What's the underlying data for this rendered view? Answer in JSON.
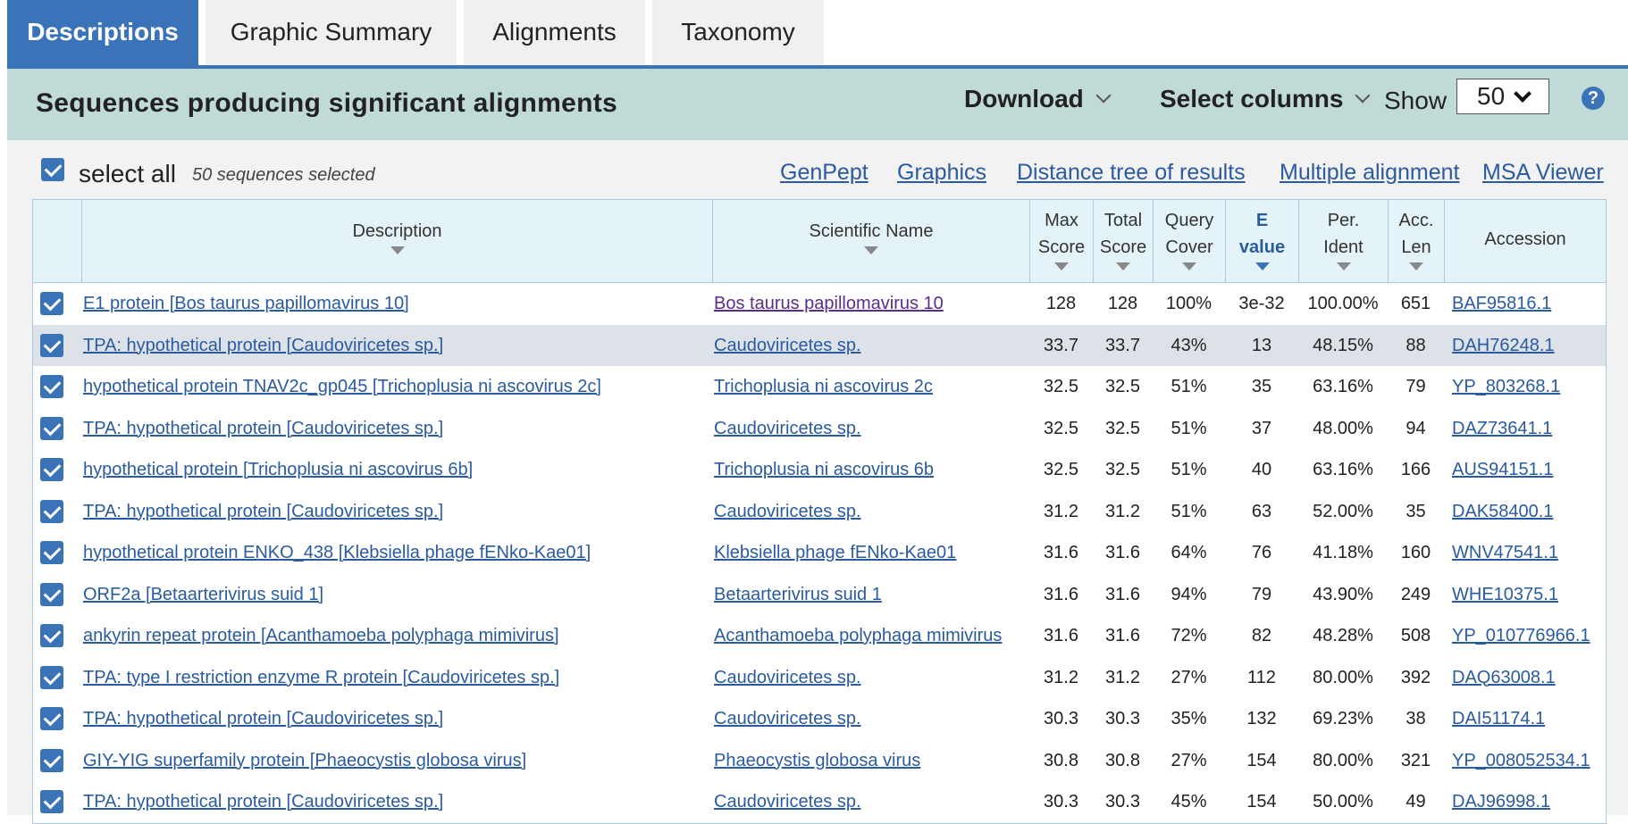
{
  "tabs": [
    {
      "label": "Descriptions",
      "active": true
    },
    {
      "label": "Graphic Summary",
      "active": false
    },
    {
      "label": "Alignments",
      "active": false
    },
    {
      "label": "Taxonomy",
      "active": false
    }
  ],
  "header": {
    "title": "Sequences producing significant alignments",
    "download_label": "Download",
    "select_columns_label": "Select columns",
    "show_label": "Show",
    "show_value": "50",
    "help_icon": "?"
  },
  "toolbar": {
    "select_all_label": "select all",
    "selected_count": "50 sequences selected",
    "links": [
      "GenPept",
      "Graphics",
      "Distance tree of results",
      "Multiple alignment",
      "MSA Viewer"
    ]
  },
  "table": {
    "headers": {
      "description": "Description",
      "scientific_name": "Scientific Name",
      "max_score_1": "Max",
      "max_score_2": "Score",
      "total_score_1": "Total",
      "total_score_2": "Score",
      "query_cover_1": "Query",
      "query_cover_2": "Cover",
      "evalue_1": "E",
      "evalue_2": "value",
      "per_ident_1": "Per.",
      "per_ident_2": "Ident",
      "acc_len_1": "Acc.",
      "acc_len_2": "Len",
      "accession": "Accession"
    },
    "rows": [
      {
        "description": "E1 protein [Bos taurus papillomavirus 10]",
        "scientific_name": "Bos taurus papillomavirus 10",
        "max_score": "128",
        "total_score": "128",
        "query_cover": "100%",
        "evalue": "3e-32",
        "per_ident": "100.00%",
        "acc_len": "651",
        "accession": "BAF95816.1"
      },
      {
        "description": "TPA: hypothetical protein [Caudoviricetes sp.]",
        "scientific_name": "Caudoviricetes sp.",
        "max_score": "33.7",
        "total_score": "33.7",
        "query_cover": "43%",
        "evalue": "13",
        "per_ident": "48.15%",
        "acc_len": "88",
        "accession": "DAH76248.1"
      },
      {
        "description": "hypothetical protein TNAV2c_gp045 [Trichoplusia ni ascovirus 2c]",
        "scientific_name": "Trichoplusia ni ascovirus 2c",
        "max_score": "32.5",
        "total_score": "32.5",
        "query_cover": "51%",
        "evalue": "35",
        "per_ident": "63.16%",
        "acc_len": "79",
        "accession": "YP_803268.1"
      },
      {
        "description": "TPA: hypothetical protein [Caudoviricetes sp.]",
        "scientific_name": "Caudoviricetes sp.",
        "max_score": "32.5",
        "total_score": "32.5",
        "query_cover": "51%",
        "evalue": "37",
        "per_ident": "48.00%",
        "acc_len": "94",
        "accession": "DAZ73641.1"
      },
      {
        "description": "hypothetical protein [Trichoplusia ni ascovirus 6b]",
        "scientific_name": "Trichoplusia ni ascovirus 6b",
        "max_score": "32.5",
        "total_score": "32.5",
        "query_cover": "51%",
        "evalue": "40",
        "per_ident": "63.16%",
        "acc_len": "166",
        "accession": "AUS94151.1"
      },
      {
        "description": "TPA: hypothetical protein [Caudoviricetes sp.]",
        "scientific_name": "Caudoviricetes sp.",
        "max_score": "31.2",
        "total_score": "31.2",
        "query_cover": "51%",
        "evalue": "63",
        "per_ident": "52.00%",
        "acc_len": "35",
        "accession": "DAK58400.1"
      },
      {
        "description": "hypothetical protein ENKO_438 [Klebsiella phage fENko-Kae01]",
        "scientific_name": "Klebsiella phage fENko-Kae01",
        "max_score": "31.6",
        "total_score": "31.6",
        "query_cover": "64%",
        "evalue": "76",
        "per_ident": "41.18%",
        "acc_len": "160",
        "accession": "WNV47541.1"
      },
      {
        "description": "ORF2a [Betaarterivirus suid 1]",
        "scientific_name": "Betaarterivirus suid 1",
        "max_score": "31.6",
        "total_score": "31.6",
        "query_cover": "94%",
        "evalue": "79",
        "per_ident": "43.90%",
        "acc_len": "249",
        "accession": "WHE10375.1"
      },
      {
        "description": "ankyrin repeat protein [Acanthamoeba polyphaga mimivirus]",
        "scientific_name": "Acanthamoeba polyphaga mimivirus",
        "max_score": "31.6",
        "total_score": "31.6",
        "query_cover": "72%",
        "evalue": "82",
        "per_ident": "48.28%",
        "acc_len": "508",
        "accession": "YP_010776966.1"
      },
      {
        "description": "TPA: type I restriction enzyme R protein [Caudoviricetes sp.]",
        "scientific_name": "Caudoviricetes sp.",
        "max_score": "31.2",
        "total_score": "31.2",
        "query_cover": "27%",
        "evalue": "112",
        "per_ident": "80.00%",
        "acc_len": "392",
        "accession": "DAQ63008.1"
      },
      {
        "description": "TPA: hypothetical protein [Caudoviricetes sp.]",
        "scientific_name": "Caudoviricetes sp.",
        "max_score": "30.3",
        "total_score": "30.3",
        "query_cover": "35%",
        "evalue": "132",
        "per_ident": "69.23%",
        "acc_len": "38",
        "accession": "DAI51174.1"
      },
      {
        "description": "GIY-YIG superfamily protein [Phaeocystis globosa virus]",
        "scientific_name": "Phaeocystis globosa virus",
        "max_score": "30.8",
        "total_score": "30.8",
        "query_cover": "27%",
        "evalue": "154",
        "per_ident": "80.00%",
        "acc_len": "321",
        "accession": "YP_008052534.1"
      },
      {
        "description": "TPA: hypothetical protein [Caudoviricetes sp.]",
        "scientific_name": "Caudoviricetes sp.",
        "max_score": "30.3",
        "total_score": "30.3",
        "query_cover": "45%",
        "evalue": "154",
        "per_ident": "50.00%",
        "acc_len": "49",
        "accession": "DAJ96998.1"
      }
    ]
  },
  "colors": {
    "accent": "#3b73b9",
    "header_band": "#c0dad7",
    "link": "#2a5ba0",
    "visited_link": "#5a2e8a",
    "table_header": "#e4f3f8",
    "highlight_row": "#dde2e8"
  }
}
